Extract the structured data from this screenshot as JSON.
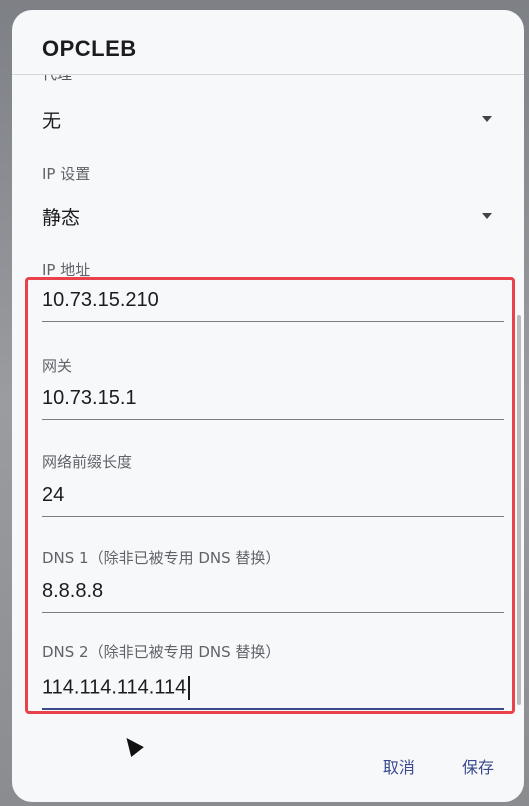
{
  "dialog": {
    "title": "OPCLEB",
    "proxy": {
      "label": "代理",
      "value": "无"
    },
    "ip_settings": {
      "label": "IP 设置",
      "value": "静态"
    },
    "ip_address": {
      "label": "IP 地址",
      "value": "10.73.15.210"
    },
    "gateway": {
      "label": "网关",
      "value": "10.73.15.1"
    },
    "prefix_length": {
      "label": "网络前缀长度",
      "value": "24"
    },
    "dns1": {
      "label": "DNS 1（除非已被专用 DNS 替换）",
      "value": "8.8.8.8"
    },
    "dns2": {
      "label": "DNS 2（除非已被专用 DNS 替换）",
      "value": "114.114.114.114"
    },
    "actions": {
      "cancel": "取消",
      "save": "保存"
    }
  },
  "icons": [
    "dropdown-caret-icon",
    "mouse-pointer-icon"
  ],
  "colors": {
    "accent": "#3b4a8f",
    "highlight_border": "#e8424a",
    "dialog_bg": "#f7f8fa"
  }
}
